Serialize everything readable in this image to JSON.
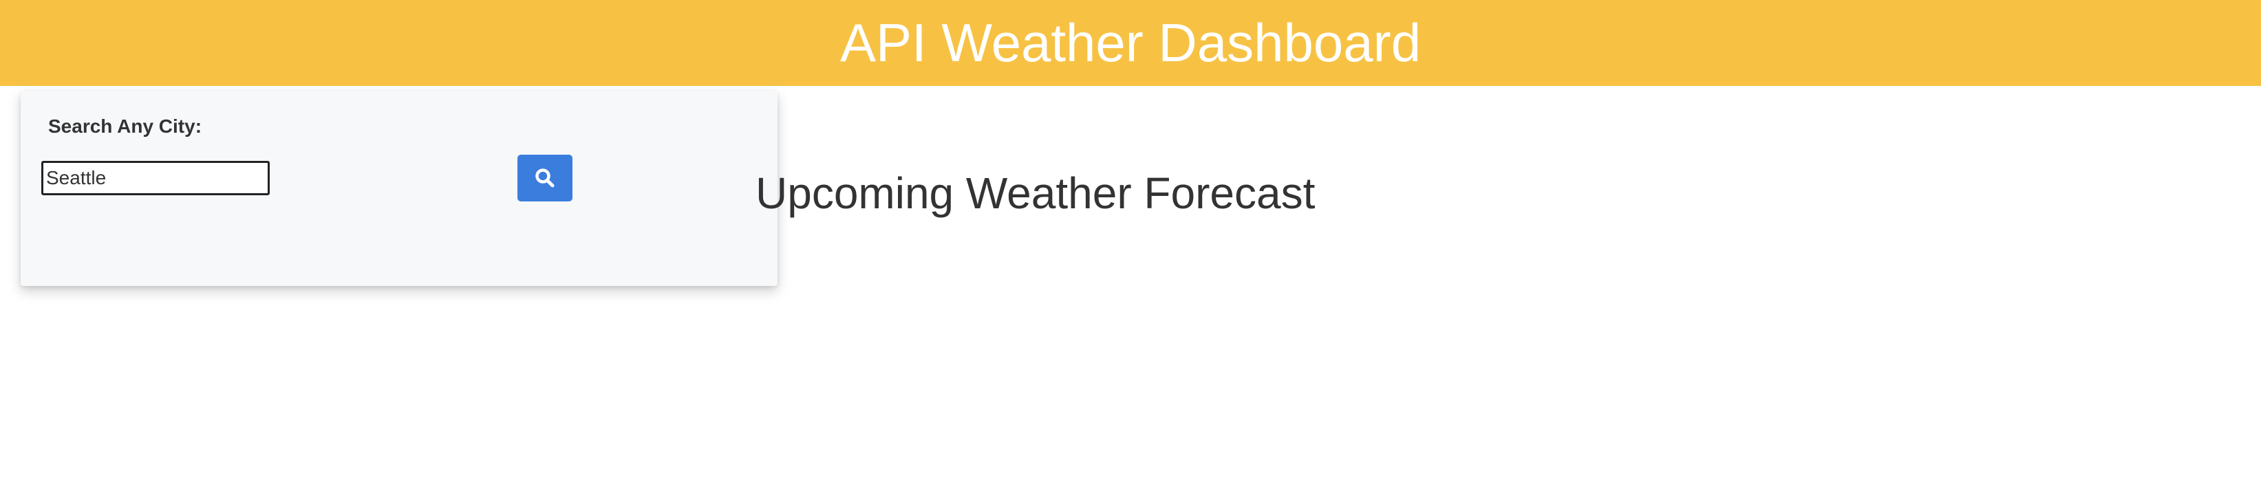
{
  "header": {
    "title": "API Weather Dashboard",
    "background_color": "#f7c244",
    "text_color": "#ffffff"
  },
  "search": {
    "label": "Search Any City:",
    "input_value": "Seattle",
    "button_icon": "search-icon",
    "button_color": "#3b7ddd"
  },
  "main": {
    "forecast_title": "Upcoming Weather Forecast"
  }
}
